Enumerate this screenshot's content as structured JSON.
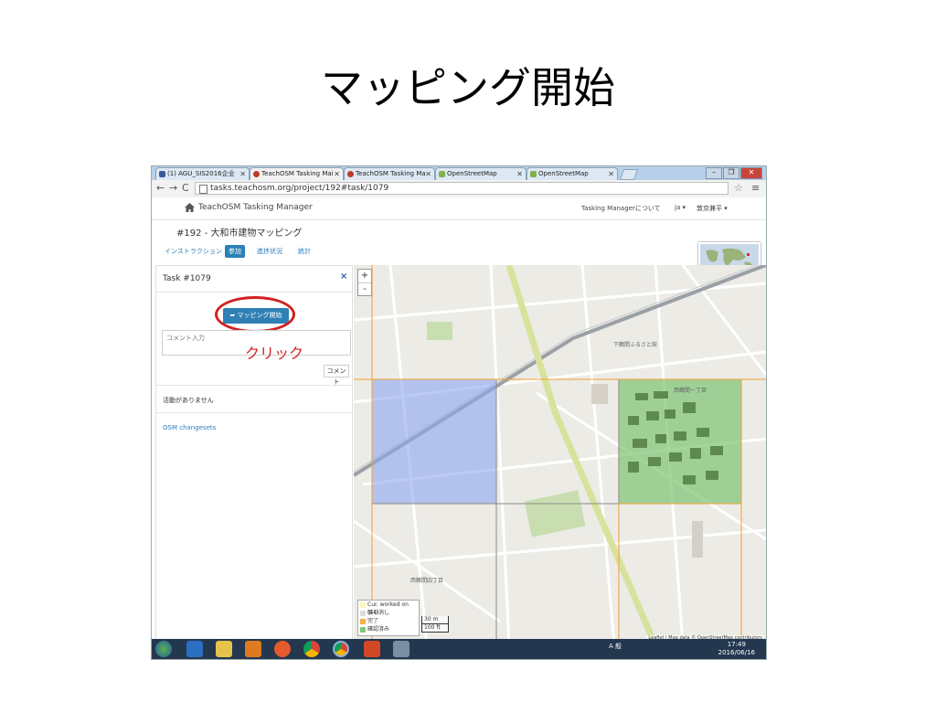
{
  "slide": {
    "title": "マッピング開始"
  },
  "browser": {
    "tabs": [
      {
        "label": "(1) AGU_SIS2016企业",
        "favicon_color": "#3b5998"
      },
      {
        "label": "TeachOSM Tasking Mai",
        "favicon_color": "#c0392b"
      },
      {
        "label": "TeachOSM Tasking Ma",
        "favicon_color": "#c0392b"
      },
      {
        "label": "OpenStreetMap",
        "favicon_color": "#7fb24c"
      },
      {
        "label": "OpenStreetMap",
        "favicon_color": "#7fb24c"
      }
    ],
    "url": "tasks.teachosm.org/project/192#task/1079",
    "back": "←",
    "forward": "→",
    "reload": "C",
    "star": "☆",
    "menu": "≡",
    "window_controls": {
      "min": "–",
      "max": "❐",
      "close": "✕"
    }
  },
  "app": {
    "brand": "TeachOSM Tasking Manager",
    "about_link": "Tasking Managerについて",
    "lang": "ja ▾",
    "user": "敦京兼平 ▾",
    "project_title": "#192 - 大和市建物マッピング",
    "tabs": [
      "インストラクション",
      "参加",
      "進捗状況",
      "統計"
    ]
  },
  "task_panel": {
    "title": "Task #1079",
    "close": "×",
    "start_button": "➦ マッピング開始",
    "comment_placeholder": "コメント入力",
    "comment_button": "コメント",
    "no_history": "活動がありません",
    "osm_changesets": "OSM changesets"
  },
  "annotation": {
    "click_note": "クリック"
  },
  "map": {
    "zoom_in": "+",
    "zoom_out": "-",
    "legend": [
      {
        "label": "Cur. worked on (44)",
        "color": "#fff4b8"
      },
      {
        "label": "取り消し",
        "color": "#dcdcdc"
      },
      {
        "label": "完了",
        "color": "#f6b042"
      },
      {
        "label": "確認済み",
        "color": "#82c878"
      }
    ],
    "scale": [
      "30 m",
      "100 ft"
    ],
    "attribution": "Leaflet | Map data © OpenStreetMap contributors",
    "labels": [
      "下鶴間ふるさと館",
      "西鶴間一丁目",
      "西鶴間四丁目"
    ],
    "cell_colors": {
      "selected": "#8ea6f0",
      "validated": "#7dc472",
      "grid": "#f0a030"
    }
  },
  "taskbar": {
    "tray_lang": "A 般",
    "time": "17:49",
    "date": "2016/06/16"
  }
}
